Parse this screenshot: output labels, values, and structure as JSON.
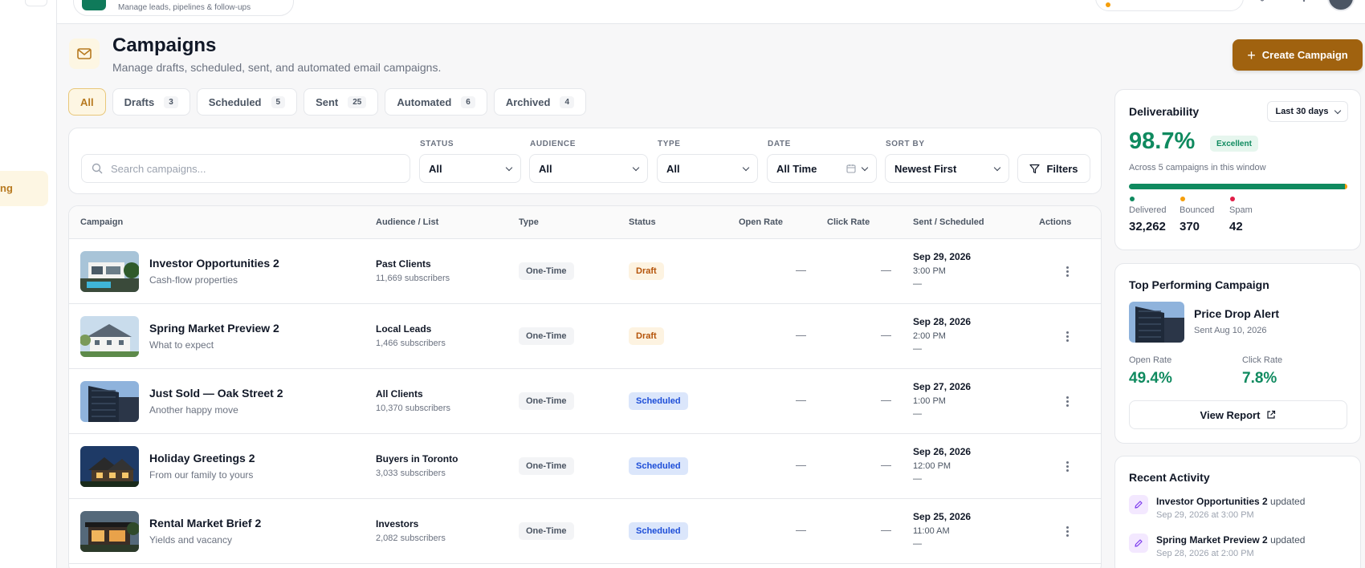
{
  "header": {
    "crm_subtitle": "Manage leads, pipelines & follow-ups"
  },
  "sidebar": {
    "active_label_fragment": "ng"
  },
  "page": {
    "title": "Campaigns",
    "subtitle": "Manage drafts, scheduled, sent, and automated email campaigns.",
    "create_button": "Create Campaign"
  },
  "tabs": [
    {
      "label": "All",
      "count": ""
    },
    {
      "label": "Drafts",
      "count": "3"
    },
    {
      "label": "Scheduled",
      "count": "5"
    },
    {
      "label": "Sent",
      "count": "25"
    },
    {
      "label": "Automated",
      "count": "6"
    },
    {
      "label": "Archived",
      "count": "4"
    }
  ],
  "filters": {
    "search_placeholder": "Search campaigns...",
    "status": {
      "label": "STATUS",
      "value": "All"
    },
    "audience": {
      "label": "AUDIENCE",
      "value": "All"
    },
    "type": {
      "label": "TYPE",
      "value": "All"
    },
    "date": {
      "label": "DATE",
      "value": "All Time"
    },
    "sort": {
      "label": "SORT BY",
      "value": "Newest First"
    },
    "filters_button": "Filters"
  },
  "table": {
    "columns": [
      "Campaign",
      "Audience / List",
      "Type",
      "Status",
      "Open Rate",
      "Click Rate",
      "Sent / Scheduled",
      "Actions"
    ],
    "rows": [
      {
        "name": "Investor Opportunities 2",
        "sub": "Cash-flow properties",
        "audience": "Past Clients",
        "subscribers": "11,669 subscribers",
        "type": "One-Time",
        "status": "Draft",
        "open": "—",
        "click": "—",
        "date": "Sep 29, 2026",
        "time": "3:00 PM",
        "extra": "—"
      },
      {
        "name": "Spring Market Preview 2",
        "sub": "What to expect",
        "audience": "Local Leads",
        "subscribers": "1,466 subscribers",
        "type": "One-Time",
        "status": "Draft",
        "open": "—",
        "click": "—",
        "date": "Sep 28, 2026",
        "time": "2:00 PM",
        "extra": "—"
      },
      {
        "name": "Just Sold — Oak Street 2",
        "sub": "Another happy move",
        "audience": "All Clients",
        "subscribers": "10,370 subscribers",
        "type": "One-Time",
        "status": "Scheduled",
        "open": "—",
        "click": "—",
        "date": "Sep 27, 2026",
        "time": "1:00 PM",
        "extra": "—"
      },
      {
        "name": "Holiday Greetings 2",
        "sub": "From our family to yours",
        "audience": "Buyers in Toronto",
        "subscribers": "3,033 subscribers",
        "type": "One-Time",
        "status": "Scheduled",
        "open": "—",
        "click": "—",
        "date": "Sep 26, 2026",
        "time": "12:00 PM",
        "extra": "—"
      },
      {
        "name": "Rental Market Brief 2",
        "sub": "Yields and vacancy",
        "audience": "Investors",
        "subscribers": "2,082 subscribers",
        "type": "One-Time",
        "status": "Scheduled",
        "open": "—",
        "click": "—",
        "date": "Sep 25, 2026",
        "time": "11:00 AM",
        "extra": "—"
      }
    ]
  },
  "deliverability": {
    "title": "Deliverability",
    "range": "Last 30 days",
    "rate": "98.7%",
    "badge": "Excellent",
    "subtitle": "Across 5 campaigns in this window",
    "delivered_label": "Delivered",
    "delivered": "32,262",
    "bounced_label": "Bounced",
    "bounced": "370",
    "spam_label": "Spam",
    "spam": "42",
    "colors": {
      "delivered": "#0f8a5f",
      "bounced": "#f59e0b",
      "spam": "#e11d48"
    }
  },
  "top_campaign": {
    "title": "Top Performing Campaign",
    "name": "Price Drop Alert",
    "sent": "Sent Aug 10, 2026",
    "open_label": "Open Rate",
    "open": "49.4%",
    "click_label": "Click Rate",
    "click": "7.8%",
    "button": "View Report"
  },
  "activity": {
    "title": "Recent Activity",
    "items": [
      {
        "name": "Investor Opportunities 2",
        "action": "updated",
        "time": "Sep 29, 2026 at 3:00 PM"
      },
      {
        "name": "Spring Market Preview 2",
        "action": "updated",
        "time": "Sep 28, 2026 at 2:00 PM"
      }
    ]
  }
}
